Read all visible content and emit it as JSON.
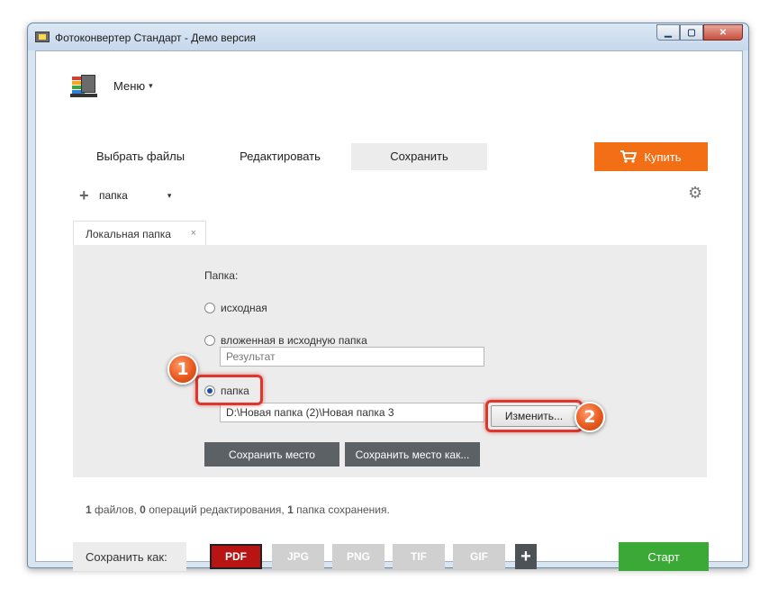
{
  "window": {
    "title": "Фотоконвертер Стандарт - Демо версия",
    "controls": {
      "minimize": "▁",
      "maximize": "▢",
      "close": "✕"
    }
  },
  "menu": {
    "label": "Меню",
    "caret": "▾"
  },
  "tabs": [
    {
      "label": "Выбрать файлы",
      "active": false
    },
    {
      "label": "Редактировать",
      "active": false
    },
    {
      "label": "Сохранить",
      "active": true
    }
  ],
  "buy_button": {
    "label": "Купить",
    "icon": "cart-icon"
  },
  "toolbar": {
    "add_icon": "+",
    "label": "папка",
    "caret": "▾",
    "settings_icon": "⚙"
  },
  "subtab": {
    "label": "Локальная папка",
    "close": "×"
  },
  "folder_settings": {
    "heading": "Папка:",
    "option_source": "исходная",
    "option_nested": "вложенная в исходную папка",
    "nested_placeholder": "Результат",
    "option_folder": "папка",
    "selected_option": "папка",
    "folder_path": "D:\\Новая папка (2)\\Новая папка 3",
    "change_button": "Изменить...",
    "save_location_button": "Сохранить место",
    "save_location_as_button": "Сохранить место как..."
  },
  "annotations": {
    "badge_1": "1",
    "badge_2": "2"
  },
  "status": {
    "files_count": "1",
    "files_text": "файлов,",
    "ops_count": "0",
    "ops_text": "операций редактирования,",
    "folders_count": "1",
    "folders_text": "папка сохранения."
  },
  "bottom_bar": {
    "save_as_label": "Сохранить как:",
    "formats": [
      "PDF",
      "JPG",
      "PNG",
      "TIF",
      "GIF"
    ],
    "active_format": "PDF",
    "add_format": "+",
    "start_button": "Старт"
  },
  "colors": {
    "buy_button": "#f26f16",
    "active_format": "#b81414",
    "start_button": "#3aa935",
    "highlight": "#e0352b",
    "badge": "#e85a1e"
  }
}
